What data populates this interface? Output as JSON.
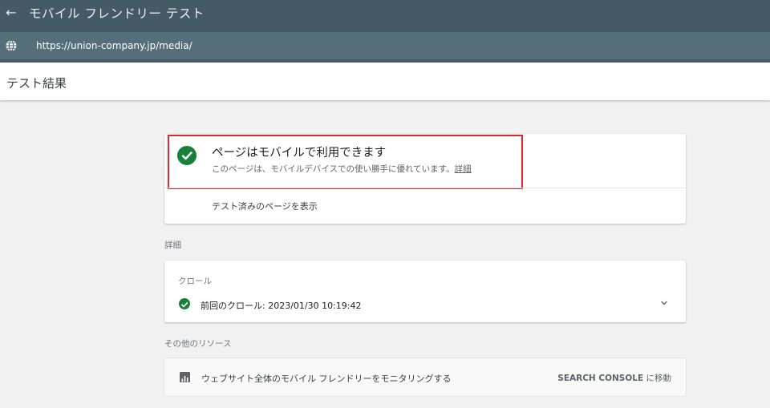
{
  "topbar": {
    "title": "モバイル フレンドリー テスト"
  },
  "urlbar": {
    "url": "https://union-company.jp/media/"
  },
  "subheader": {
    "title": "テスト結果"
  },
  "result": {
    "title": "ページはモバイルで利用できます",
    "description": "このページは、モバイルデバイスでの使い勝手に優れています。",
    "details_link": "詳細",
    "view_tested_page": "テスト済みのページを表示"
  },
  "details": {
    "section_label": "詳細",
    "crawl_label": "クロール",
    "last_crawl": "前回のクロール: 2023/01/30 10:19:42"
  },
  "resources": {
    "section_label": "その他のリソース",
    "monitor_text": "ウェブサイト全体のモバイル フレンドリーをモニタリングする",
    "console_link": "SEARCH CONSOLE",
    "console_suffix": " に移動"
  },
  "colors": {
    "topbar": "#455a64",
    "urlbar": "#546e7a",
    "success_green": "#188038",
    "highlight_red": "#e0262a"
  },
  "icons": [
    "back-arrow-icon",
    "globe-icon",
    "check-circle-icon",
    "chevron-down-icon",
    "bar-chart-icon"
  ]
}
